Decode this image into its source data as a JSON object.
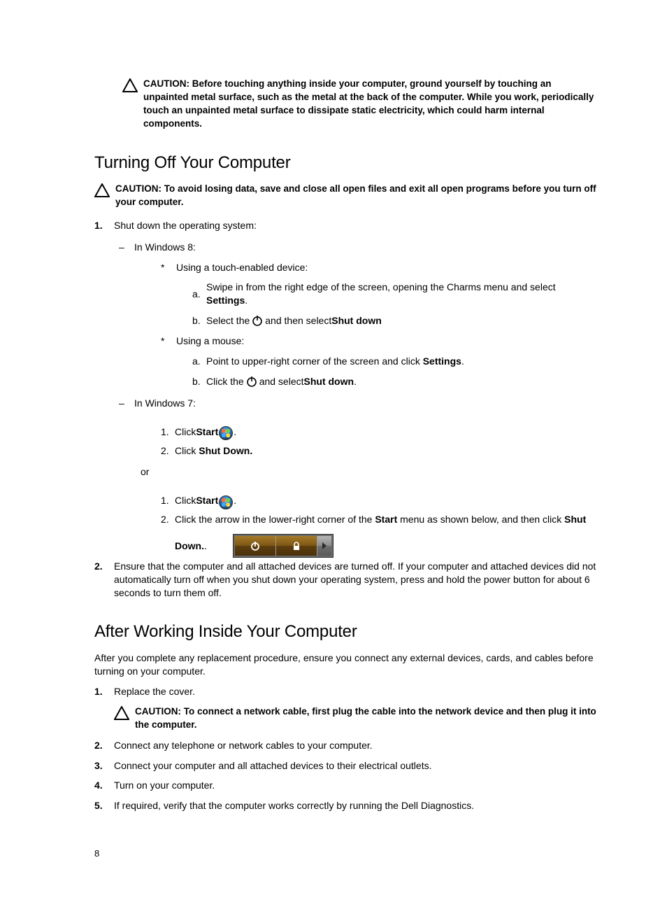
{
  "caution_top": "CAUTION: Before touching anything inside your computer, ground yourself by touching an unpainted metal surface, such as the metal at the back of the computer. While you work, periodically touch an unpainted metal surface to dissipate static electricity, which could harm internal components.",
  "h_turn_off": "Turning Off Your Computer",
  "caution_turnoff": "CAUTION: To avoid losing data, save and close all open files and exit all open programs before you turn off your computer.",
  "step1_num": "1.",
  "step1_text": "Shut down the operating system:",
  "win8_label": "In Windows 8:",
  "touch_label": "Using a touch-enabled device:",
  "touch_a_mark": "a.",
  "touch_a_pre": "Swipe in from the right edge of the screen, opening the Charms menu and select ",
  "touch_a_bold": "Settings",
  "touch_a_post": ".",
  "touch_b_mark": "b.",
  "touch_b_pre": "Select the ",
  "touch_b_mid": " and then select ",
  "touch_b_bold": "Shut down",
  "mouse_label": "Using a mouse:",
  "mouse_a_mark": "a.",
  "mouse_a_pre": "Point to upper-right corner of the screen and click ",
  "mouse_a_bold": "Settings",
  "mouse_a_post": ".",
  "mouse_b_mark": "b.",
  "mouse_b_pre": "Click the ",
  "mouse_b_mid": " and select ",
  "mouse_b_bold": "Shut down",
  "mouse_b_post": ".",
  "win7_label": "In Windows 7:",
  "w7a1_mark": "1.",
  "w7a1_pre": "Click ",
  "w7a1_bold": "Start",
  "w7a1_post": ".",
  "w7a2_mark": "2.",
  "w7a2_pre": "Click ",
  "w7a2_bold": "Shut Down.",
  "or_text": "or",
  "w7b1_mark": "1.",
  "w7b1_pre": "Click ",
  "w7b1_bold": "Start",
  "w7b1_post": ".",
  "w7b2_mark": "2.",
  "w7b2_pre": "Click the arrow in the lower-right corner of the ",
  "w7b2_bold1": "Start",
  "w7b2_mid": " menu as shown below, and then click ",
  "w7b2_bold2": "Shut",
  "w7b2_down": "Down.",
  "step2_num": "2.",
  "step2_text": "Ensure that the computer and all attached devices are turned off. If your computer and attached devices did not automatically turn off when you shut down your operating system, press and hold the power button for about 6 seconds to turn them off.",
  "h_after": "After Working Inside Your Computer",
  "after_para": "After you complete any replacement procedure, ensure you connect any external devices, cards, and cables before turning on your computer.",
  "a1_num": "1.",
  "a1_text": "Replace the cover.",
  "caution_net": "CAUTION: To connect a network cable, first plug the cable into the network device and then plug it into the computer.",
  "a2_num": "2.",
  "a2_text": "Connect any telephone or network cables to your computer.",
  "a3_num": "3.",
  "a3_text": "Connect your computer and all attached devices to their electrical outlets.",
  "a4_num": "4.",
  "a4_text": "Turn on your computer.",
  "a5_num": "5.",
  "a5_text": "If required, verify that the computer works correctly by running the Dell Diagnostics.",
  "page_number": "8"
}
